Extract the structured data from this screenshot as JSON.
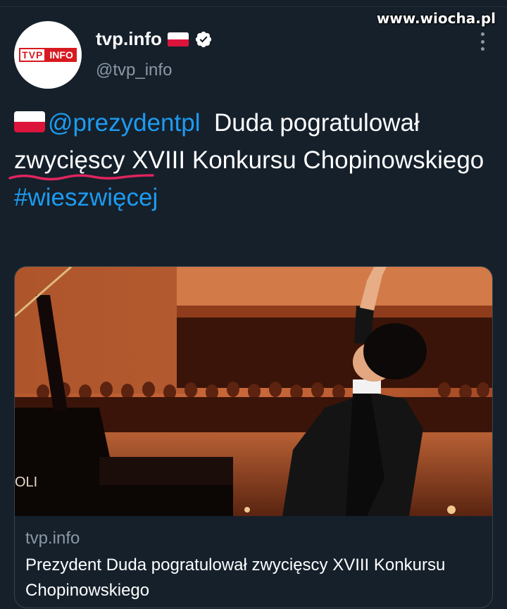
{
  "watermark": "www.wiocha.pl",
  "account": {
    "avatar_logo_left": "TVP",
    "avatar_logo_right": "INFO",
    "display_name": "tvp.info",
    "handle": "@tvp_info",
    "icons": [
      "polish-flag-icon",
      "verified-badge-icon",
      "more-options-icon"
    ]
  },
  "tweet": {
    "mention": "@prezydentpl",
    "text_part1": "Duda pogratulował",
    "highlighted_word": "zwycięscy",
    "text_part2": "XVIII Konkursu Chopinowskiego",
    "hashtag": "#wieszwięcej"
  },
  "card": {
    "domain": "tvp.info",
    "title": "Prezydent Duda pogratulował zwycięscy XVIII Konkursu Chopinowskiego",
    "piano_brand_fragment": "OLI"
  },
  "colors": {
    "background": "#15202b",
    "link": "#1d9bf0",
    "secondary_text": "#8b98a5",
    "squiggle": "#e0245e",
    "flag_red": "#dc143c"
  }
}
